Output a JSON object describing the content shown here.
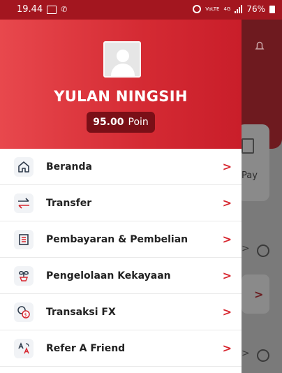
{
  "status_bar": {
    "time": "19.44",
    "battery": "76%",
    "network": "4G",
    "lte": "VoLTE"
  },
  "profile": {
    "name": "YULAN NINGSIH",
    "points_value": "95.00",
    "points_label": "Poin"
  },
  "menu": {
    "items": [
      {
        "label": "Beranda",
        "icon": "home-icon"
      },
      {
        "label": "Transfer",
        "icon": "transfer-icon"
      },
      {
        "label": "Pembayaran & Pembelian",
        "icon": "receipt-icon"
      },
      {
        "label": "Pengelolaan Kekayaan",
        "icon": "plant-icon"
      },
      {
        "label": "Transaksi FX",
        "icon": "currency-exchange-icon"
      },
      {
        "label": "Refer A Friend",
        "icon": "translate-icon"
      }
    ]
  },
  "background": {
    "pay_text": "Pay"
  },
  "colors": {
    "brand_red": "#d42a33",
    "dark_red": "#7a0f17",
    "chevron": "#d7262f"
  }
}
